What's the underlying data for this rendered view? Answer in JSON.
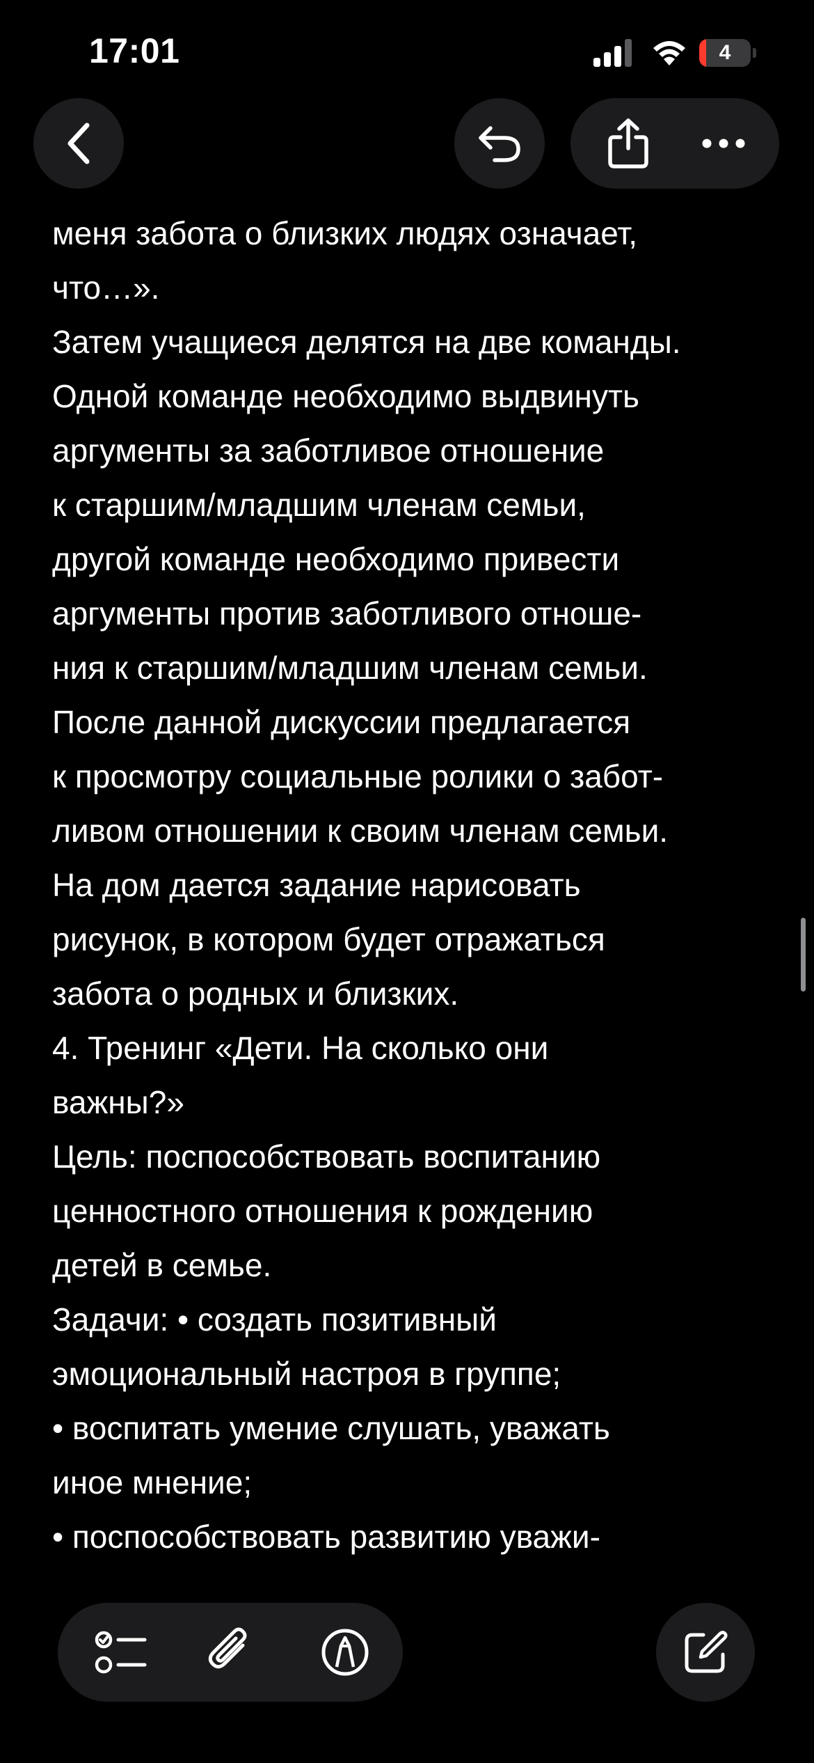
{
  "status_bar": {
    "time": "17:01",
    "battery_level": "4",
    "battery_color": "#ff3b30"
  },
  "nav": {
    "back_icon": "chevron-left-icon",
    "undo_icon": "undo-icon",
    "share_icon": "share-icon",
    "more_icon": "ellipsis-icon"
  },
  "note": {
    "lines": [
      "меня забота о близких людях означает,",
      "что…».",
      "Затем учащиеся делятся на две команды.",
      "Одной команде необходимо выдвинуть",
      "аргументы за заботливое отношение",
      "к старшим/младшим членам семьи,",
      "другой команде необходимо привести",
      "аргументы против заботливого отноше-",
      "ния к старшим/младшим членам семьи.",
      "После данной дискуссии предлагается",
      "к просмотру социальные ролики о забот-",
      "ливом отношении к своим членам семьи.",
      "На дом дается задание нарисовать",
      "рисунок, в котором будет отражаться",
      "забота о родных и близких.",
      "4. Тренинг «Дети. На сколько они",
      "важны?»",
      "Цель: поспособствовать воспитанию",
      "ценностного отношения к рождению",
      "детей в семье.",
      "Задачи: • создать позитивный",
      "эмоциональный настроя в группе;",
      "• воспитать умение слушать, уважать",
      "иное мнение;",
      "• поспособствовать развитию уважи-"
    ]
  },
  "toolbar": {
    "checklist_icon": "checklist-icon",
    "attach_icon": "paperclip-icon",
    "markup_icon": "markup-pen-icon",
    "compose_icon": "compose-icon"
  },
  "colors": {
    "background": "#000000",
    "button_bg": "#1c1c1e",
    "text": "#ffffff"
  }
}
